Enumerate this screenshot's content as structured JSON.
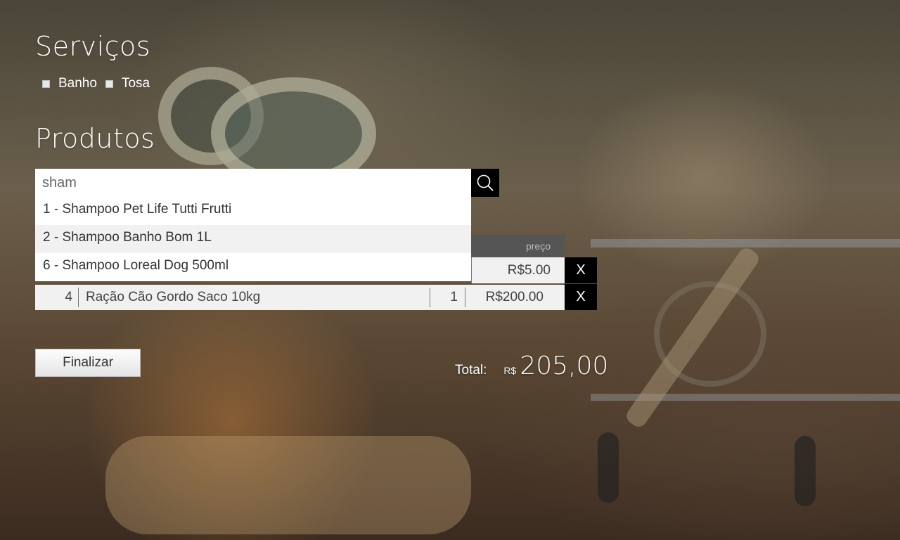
{
  "services": {
    "title": "Serviços",
    "options": [
      {
        "label": "Banho",
        "checked": false
      },
      {
        "label": "Tosa",
        "checked": false
      }
    ]
  },
  "products": {
    "title": "Produtos",
    "search": {
      "value": "sham",
      "icon": "search-icon"
    },
    "suggestions": [
      "1 - Shampoo Pet Life Tutti Frutti",
      "2 - Shampoo Banho Bom 1L",
      "6 - Shampoo Loreal Dog 500ml"
    ],
    "table": {
      "price_header": "preço",
      "rows": [
        {
          "id": "",
          "name": "",
          "qty": "",
          "price": "R$5.00",
          "remove": "X"
        },
        {
          "id": "4",
          "name": "Ração Cão Gordo Saco 10kg",
          "qty": "1",
          "price": "R$200.00",
          "remove": "X"
        }
      ]
    }
  },
  "finalize_label": "Finalizar",
  "total": {
    "label": "Total:",
    "currency": "R$",
    "value": "205,00"
  }
}
